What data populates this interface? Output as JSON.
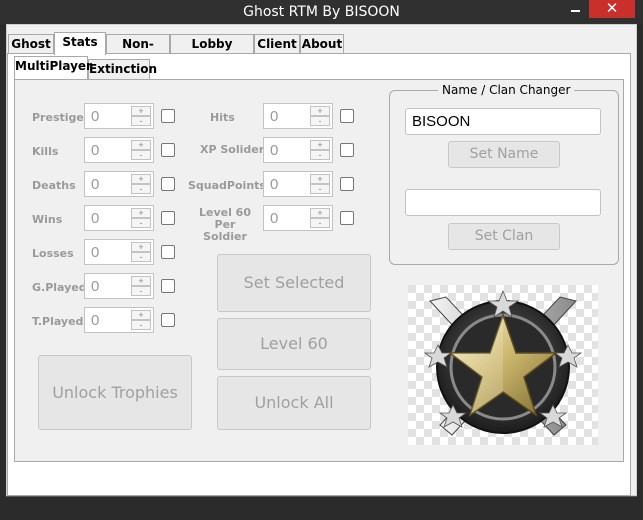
{
  "window": {
    "title": "Ghost RTM By BISOON",
    "minimize_symbol": "",
    "close_symbol": "✕"
  },
  "main_tabs": [
    {
      "label": "Ghost",
      "active": false
    },
    {
      "label": "Stats",
      "active": true
    },
    {
      "label": "Non-Host",
      "active": false
    },
    {
      "label": "Lobby Setting",
      "active": false
    },
    {
      "label": "Client",
      "active": false
    },
    {
      "label": "About",
      "active": false
    }
  ],
  "sub_tabs": [
    {
      "label": "MultiPlayer",
      "active": true
    },
    {
      "label": "Extinction",
      "active": false
    }
  ],
  "left_stats": [
    {
      "label": "Prestige",
      "value": "0"
    },
    {
      "label": "Kills",
      "value": "0"
    },
    {
      "label": "Deaths",
      "value": "0"
    },
    {
      "label": "Wins",
      "value": "0"
    },
    {
      "label": "Losses",
      "value": "0"
    },
    {
      "label": "G.Played",
      "value": "0"
    },
    {
      "label": "T.Played",
      "value": "0"
    }
  ],
  "right_stats": [
    {
      "label": "Hits",
      "value": "0"
    },
    {
      "label": "XP Solider",
      "value": "0"
    },
    {
      "label": "SquadPoints",
      "value": "0"
    },
    {
      "label": "Level 60\nPer Soldier",
      "line1": "Level 60",
      "line2": "Per Soldier",
      "value": "0"
    }
  ],
  "spin_up": "+",
  "spin_down": "-",
  "buttons": {
    "set_selected": "Set Selected",
    "level_60": "Level 60",
    "unlock_all": "Unlock All",
    "unlock_trophies": "Unlock Trophies"
  },
  "name_clan": {
    "group_title": "Name / Clan Changer",
    "name_value": "BISOON",
    "set_name": "Set Name",
    "clan_value": "",
    "set_clan": "Set Clan"
  },
  "emblem": {
    "icon": "prestige-star-emblem-icon"
  }
}
